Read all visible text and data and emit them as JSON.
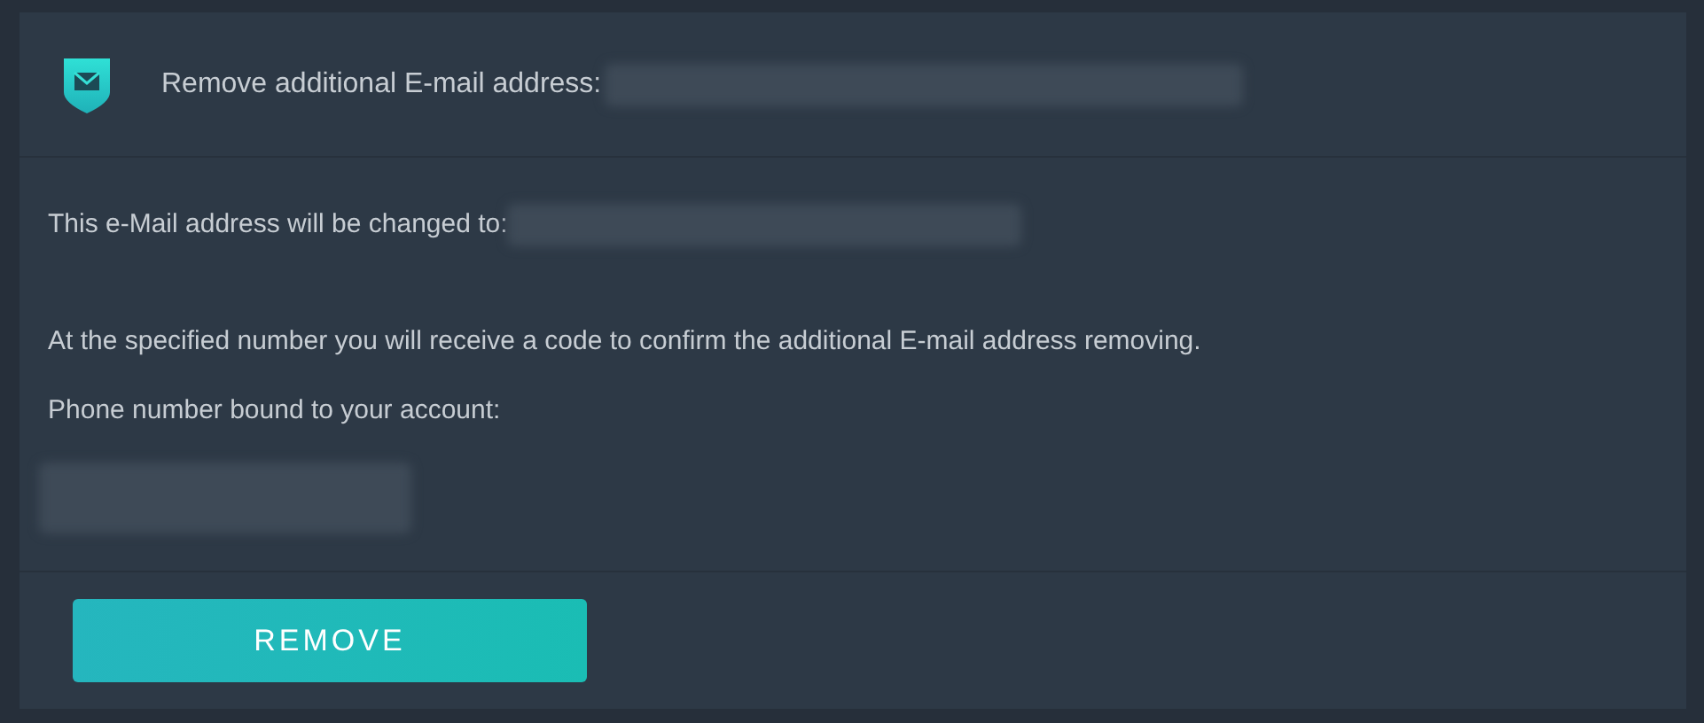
{
  "header": {
    "title": "Remove additional E-mail address:"
  },
  "body": {
    "change_label": "This e-Mail address will be changed to:",
    "notice": "At the specified number you will receive a code to confirm the additional E-mail address removing.",
    "phone_label": "Phone number bound to your account:"
  },
  "buttons": [
    "REMOVE"
  ]
}
